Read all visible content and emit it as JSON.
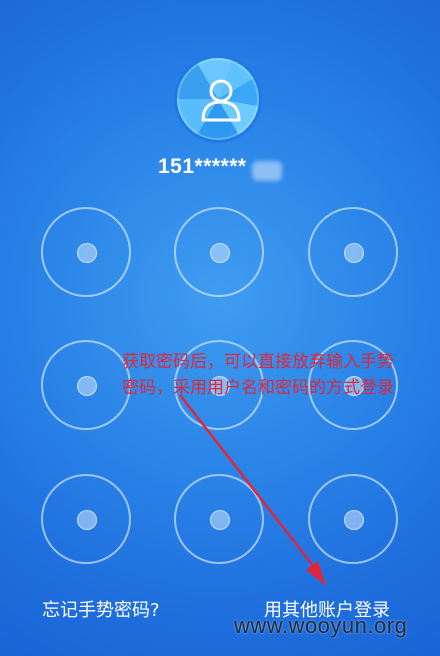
{
  "user": {
    "avatar_icon": "user-icon",
    "account_masked": "151******"
  },
  "pattern_nodes": [
    {
      "row": 1,
      "col": 1
    },
    {
      "row": 1,
      "col": 2
    },
    {
      "row": 1,
      "col": 3
    },
    {
      "row": 2,
      "col": 1
    },
    {
      "row": 2,
      "col": 2
    },
    {
      "row": 2,
      "col": 3
    },
    {
      "row": 3,
      "col": 1
    },
    {
      "row": 3,
      "col": 2
    },
    {
      "row": 3,
      "col": 3
    }
  ],
  "annotation": {
    "line1": "获取密码后，可以直接放弃输入手势",
    "line2": "密码，采用用户名和密码的方式登录",
    "color": "#e0263a"
  },
  "footer": {
    "forgot_label": "忘记手势密码?",
    "other_account_label": "用其他账户登录"
  },
  "watermark": "www.wooyun.org",
  "colors": {
    "background": "#2b85e8",
    "node_ring": "#dceeff"
  }
}
